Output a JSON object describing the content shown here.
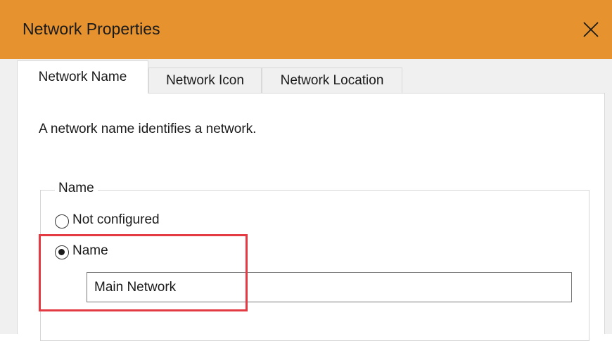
{
  "window": {
    "title": "Network Properties",
    "close_icon": "close-icon"
  },
  "tabs": [
    {
      "label": "Network Name",
      "active": true
    },
    {
      "label": "Network Icon",
      "active": false
    },
    {
      "label": "Network Location",
      "active": false
    }
  ],
  "panel": {
    "description": "A network name identifies a network.",
    "group": {
      "legend": "Name",
      "options": [
        {
          "label": "Not configured",
          "selected": false
        },
        {
          "label": "Name",
          "selected": true
        }
      ],
      "name_input_value": "Main Network"
    }
  },
  "colors": {
    "titlebar": "#e5922f",
    "highlight": "#e33a43",
    "panel_background": "#ffffff",
    "window_background": "#f0f0f0"
  }
}
